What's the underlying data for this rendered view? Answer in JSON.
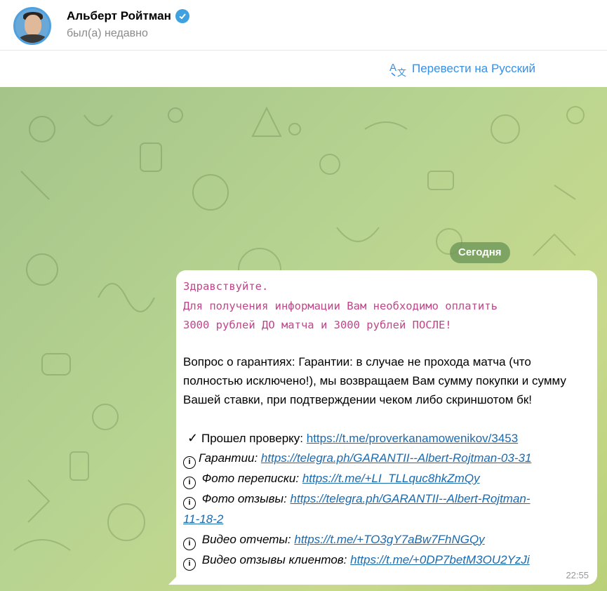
{
  "header": {
    "name": "Альберт Ройтман",
    "status": "был(а) недавно",
    "verified_icon": "verified-check-icon"
  },
  "translate": {
    "label": "Перевести на Русский",
    "icon": "translate-icon"
  },
  "chat": {
    "date_label": "Сегодня",
    "message": {
      "mono_lines": [
        "Здравствуйте.",
        "Для получения информации Вам необходимо оплатить",
        "3000 рублей ДО матча и 3000 рублей ПОСЛЕ!"
      ],
      "guarantee_text": "Вопрос о гарантиях: Гарантии: в случае не прохода матча (что полностью исключено!), мы возвращаем Вам сумму покупки и сумму Вашей ставки, при подтверждении чеком либо скриншотом бк!",
      "links": [
        {
          "icon": "✓",
          "label": "Прошел проверку: ",
          "url": "https://t.me/proverkanamowenikov/3453",
          "italic": false
        },
        {
          "icon": "i",
          "label": "Гарантии: ",
          "url": "https://telegra.ph/GARANTII--Albert-Rojtman-03-31",
          "italic": true
        },
        {
          "icon": "i",
          "label": "Фото переписки: ",
          "url": "https://t.me/+LI_TLLquc8hkZmQy",
          "italic": true
        },
        {
          "icon": "i",
          "label": "Фото отзывы:  ",
          "url": "https://telegra.ph/GARANTII--Albert-Rojtman-",
          "url_cont": "11-18-2",
          "italic": true
        },
        {
          "icon": "i",
          "label": "Видео отчеты: ",
          "url": "https://t.me/+TO3gY7aBw7FhNGQy",
          "italic": true
        },
        {
          "icon": "i",
          "label": "Видео отзывы клиентов: ",
          "url": "https://t.me/+0DP7betM3OU2YzJi",
          "italic": true
        }
      ],
      "time": "22:55"
    }
  }
}
